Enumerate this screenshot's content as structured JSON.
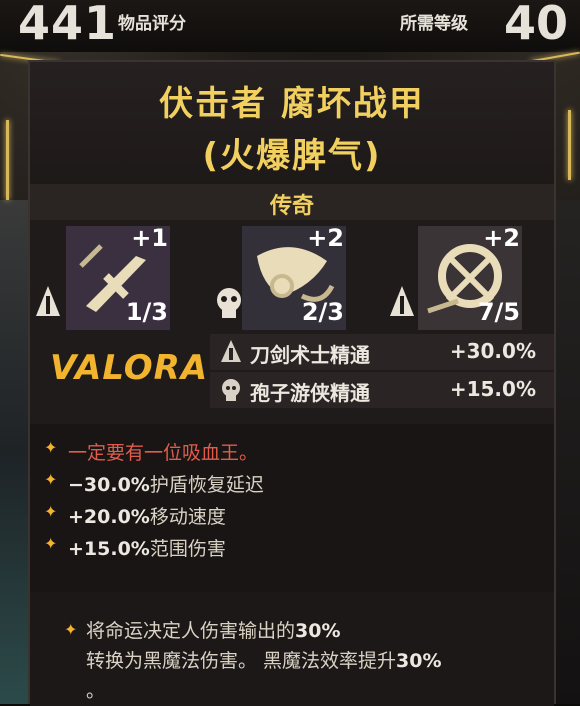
{
  "header": {
    "item_score": "441",
    "item_score_label": "物品评分",
    "required_level_label": "所需等级",
    "required_level": "40"
  },
  "item": {
    "name_line1": "伏击者 腐坏战甲",
    "name_line2": "(火爆脾气)",
    "rarity": "传奇"
  },
  "aspects": [
    {
      "bonus": "+1",
      "count": "1/3",
      "icon": "sword-rune-icon",
      "class_icon": "blademaster-class-icon"
    },
    {
      "bonus": "+2",
      "count": "2/3",
      "icon": "creature-rune-icon",
      "class_icon": "spore-ranger-class-icon"
    },
    {
      "bonus": "+2",
      "count": "7/5",
      "icon": "chaos-rune-icon",
      "class_icon": "blademaster-class-icon"
    }
  ],
  "brand": "VALORA",
  "stats": [
    {
      "label": "刀剑术士精通",
      "value": "+30.0%",
      "icon": "blademaster-class-icon"
    },
    {
      "label": "孢子游侠精通",
      "value": "+15.0%",
      "icon": "spore-ranger-class-icon"
    }
  ],
  "affixes": [
    {
      "num": "",
      "text": "一定要有一位吸血王。",
      "style": "red"
    },
    {
      "num": "−30.0%",
      "text": "护盾恢复延迟",
      "style": "normal"
    },
    {
      "num": "+20.0%",
      "text": "移动速度",
      "style": "normal"
    },
    {
      "num": "+15.0%",
      "text": "范围伤害",
      "style": "normal"
    }
  ],
  "legendary": {
    "part1": "将命运决定人伤害输出的",
    "num1": "30%",
    "part2": "转换为黑魔法伤害。 黑魔法效率提升",
    "num2": "30%",
    "part3": "。"
  },
  "colors": {
    "title": "#f2d060",
    "accent": "#f2b42e",
    "negative": "#e05c4c"
  }
}
